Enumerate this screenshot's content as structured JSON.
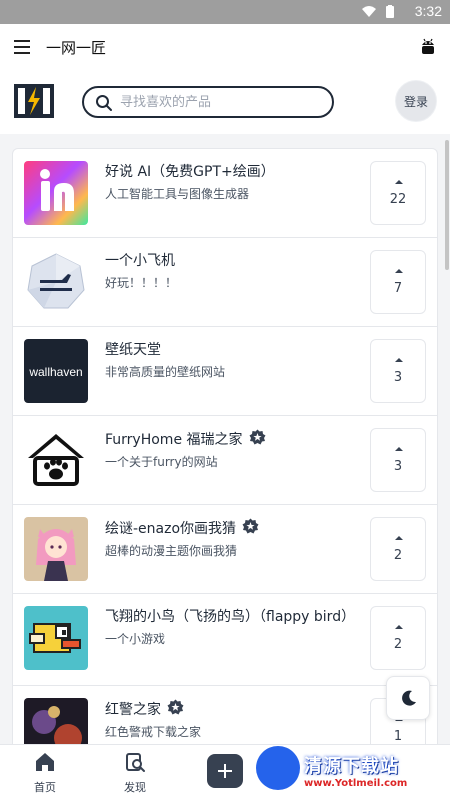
{
  "status_bar": {
    "time": "3:32"
  },
  "app_bar": {
    "title": "一网一匠"
  },
  "search": {
    "placeholder": "寻找喜欢的产品"
  },
  "login_label": "登录",
  "items": [
    {
      "title": "好说 AI（免费GPT+绘画）",
      "desc": "人工智能工具与图像生成器",
      "votes": "22",
      "verified": false
    },
    {
      "title": "一个小飞机",
      "desc": "好玩！！！！",
      "votes": "7",
      "verified": false
    },
    {
      "title": "壁纸天堂",
      "desc": "非常高质量的壁纸网站",
      "votes": "3",
      "verified": false,
      "thumb_text": "wallhaven"
    },
    {
      "title": "FurryHome 福瑞之家",
      "desc": "一个关于furry的网站",
      "votes": "3",
      "verified": true
    },
    {
      "title": "绘谜-enazo你画我猜",
      "desc": "超棒的动漫主题你画我猜",
      "votes": "2",
      "verified": true
    },
    {
      "title": "飞翔的小鸟（飞扬的鸟）（flappy bird）",
      "desc": "一个小游戏",
      "votes": "2",
      "verified": false
    },
    {
      "title": "红警之家",
      "desc": "红色警戒下载之家",
      "votes": "1",
      "verified": true
    }
  ],
  "bottom_nav": {
    "home": "首页",
    "discover": "发现"
  },
  "watermark": {
    "text": "清源下载站",
    "url": "www.Yotlmeil.com"
  },
  "colors": {
    "accent_dark": "#374151",
    "border": "#e5e7eb",
    "watermark_blue": "#2563eb"
  }
}
